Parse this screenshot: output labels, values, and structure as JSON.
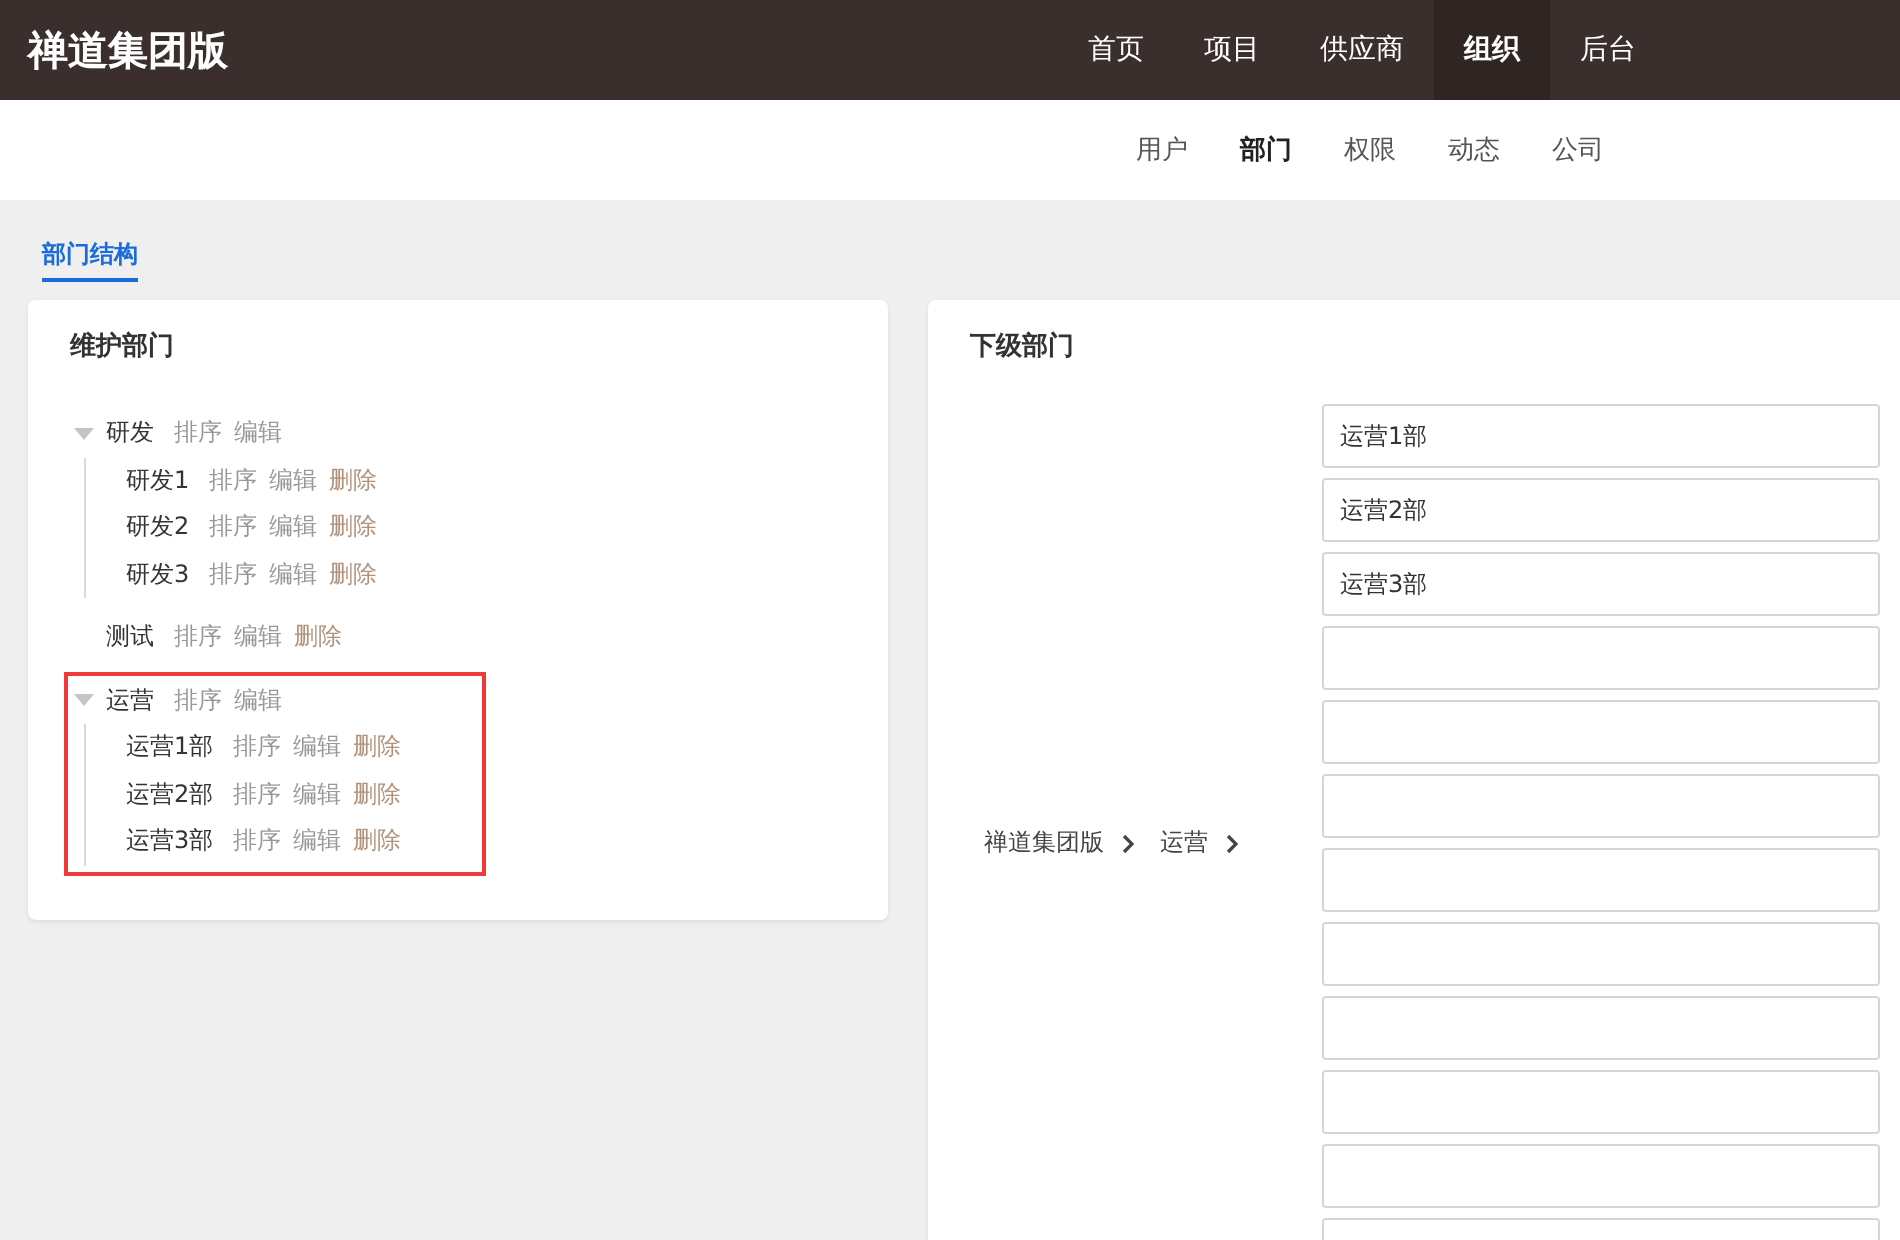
{
  "brand": "禅道集团版",
  "main_nav": [
    {
      "label": "首页",
      "selected": false
    },
    {
      "label": "项目",
      "selected": false
    },
    {
      "label": "供应商",
      "selected": false
    },
    {
      "label": "组织",
      "selected": true
    },
    {
      "label": "后台",
      "selected": false
    }
  ],
  "sub_nav": [
    {
      "label": "用户",
      "selected": false
    },
    {
      "label": "部门",
      "selected": true
    },
    {
      "label": "权限",
      "selected": false
    },
    {
      "label": "动态",
      "selected": false
    },
    {
      "label": "公司",
      "selected": false
    }
  ],
  "page_tab": {
    "label": "部门结构",
    "selected": true
  },
  "tree_panel": {
    "title": "维护部门",
    "nodes": [
      {
        "name": "研发",
        "expanded": true,
        "highlighted": false,
        "actions": [
          {
            "label": "排序",
            "kind": "sort"
          },
          {
            "label": "编辑",
            "kind": "edit"
          }
        ],
        "children": [
          {
            "name": "研发1",
            "actions": [
              {
                "label": "排序",
                "kind": "sort"
              },
              {
                "label": "编辑",
                "kind": "edit"
              },
              {
                "label": "删除",
                "kind": "delete"
              }
            ]
          },
          {
            "name": "研发2",
            "actions": [
              {
                "label": "排序",
                "kind": "sort"
              },
              {
                "label": "编辑",
                "kind": "edit"
              },
              {
                "label": "删除",
                "kind": "delete"
              }
            ]
          },
          {
            "name": "研发3",
            "actions": [
              {
                "label": "排序",
                "kind": "sort"
              },
              {
                "label": "编辑",
                "kind": "edit"
              },
              {
                "label": "删除",
                "kind": "delete"
              }
            ]
          }
        ]
      },
      {
        "name": "测试",
        "highlighted": false,
        "actions": [
          {
            "label": "排序",
            "kind": "sort"
          },
          {
            "label": "编辑",
            "kind": "edit"
          },
          {
            "label": "删除",
            "kind": "delete"
          }
        ]
      },
      {
        "name": "运营",
        "expanded": true,
        "highlighted": true,
        "actions": [
          {
            "label": "排序",
            "kind": "sort"
          },
          {
            "label": "编辑",
            "kind": "edit"
          }
        ],
        "children": [
          {
            "name": "运营1部",
            "actions": [
              {
                "label": "排序",
                "kind": "sort"
              },
              {
                "label": "编辑",
                "kind": "edit"
              },
              {
                "label": "删除",
                "kind": "delete"
              }
            ]
          },
          {
            "name": "运营2部",
            "actions": [
              {
                "label": "排序",
                "kind": "sort"
              },
              {
                "label": "编辑",
                "kind": "edit"
              },
              {
                "label": "删除",
                "kind": "delete"
              }
            ]
          },
          {
            "name": "运营3部",
            "actions": [
              {
                "label": "排序",
                "kind": "sort"
              },
              {
                "label": "编辑",
                "kind": "edit"
              },
              {
                "label": "删除",
                "kind": "delete"
              }
            ]
          }
        ]
      }
    ]
  },
  "child_panel": {
    "title": "下级部门",
    "breadcrumb": [
      "禅道集团版",
      "运营"
    ],
    "fields": [
      {
        "kind": "text",
        "value": "运营1部"
      },
      {
        "kind": "text",
        "value": "运营2部"
      },
      {
        "kind": "text",
        "value": "运营3部"
      },
      {
        "kind": "text"
      },
      {
        "kind": "text"
      },
      {
        "kind": "text"
      },
      {
        "kind": "text"
      },
      {
        "kind": "text"
      },
      {
        "kind": "text"
      },
      {
        "kind": "text"
      },
      {
        "kind": "text"
      },
      {
        "kind": "text"
      }
    ]
  }
}
